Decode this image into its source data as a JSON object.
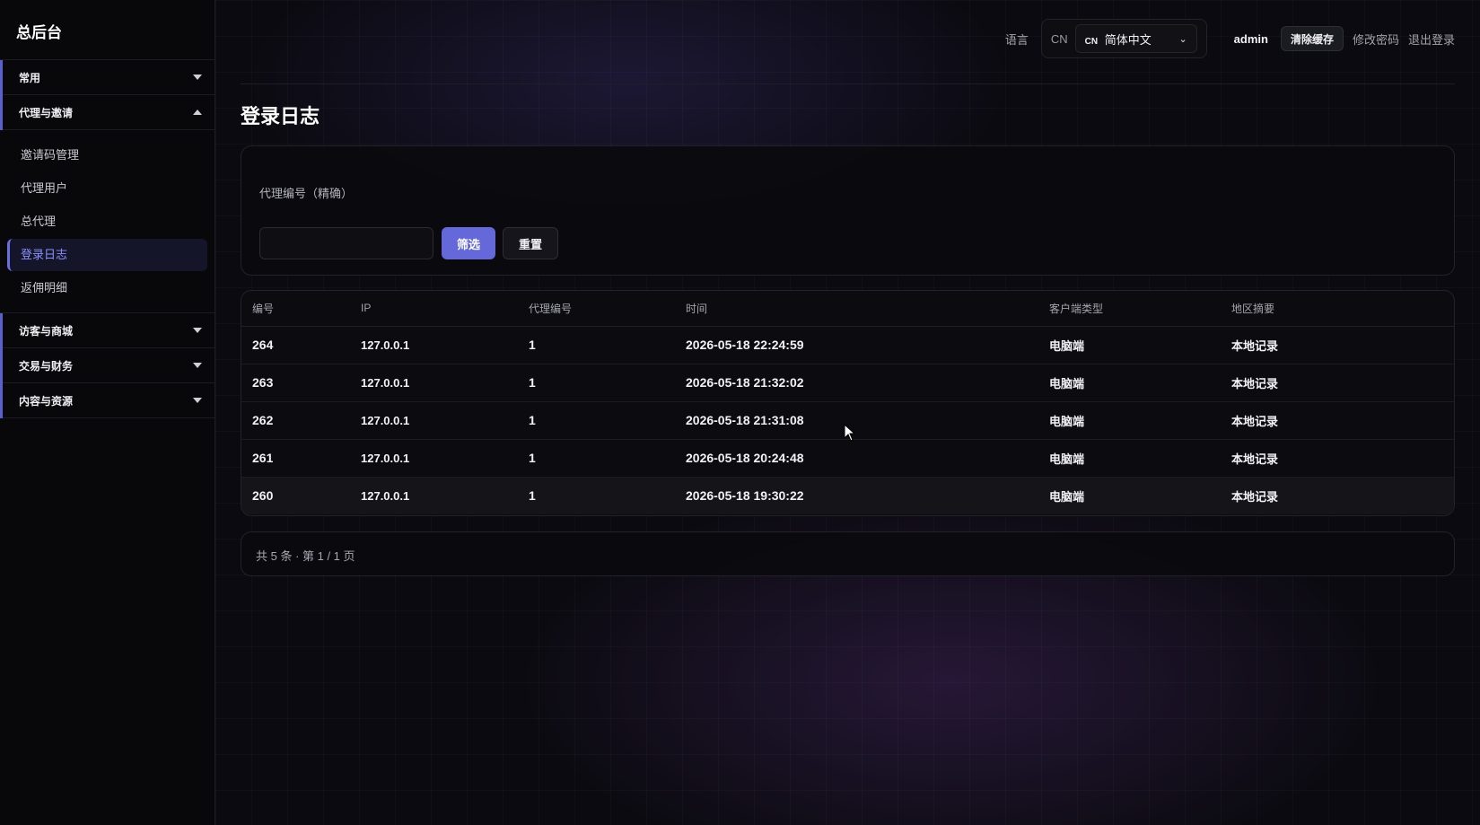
{
  "app": {
    "brand": "总后台"
  },
  "sidebar": {
    "groups": [
      {
        "label": "常用",
        "expanded": false
      },
      {
        "label": "代理与邀请",
        "expanded": true,
        "items": [
          {
            "label": "邀请码管理"
          },
          {
            "label": "代理用户"
          },
          {
            "label": "总代理"
          },
          {
            "label": "登录日志",
            "active": true
          },
          {
            "label": "返佣明细"
          }
        ]
      },
      {
        "label": "访客与商城",
        "expanded": false
      },
      {
        "label": "交易与财务",
        "expanded": false
      },
      {
        "label": "内容与资源",
        "expanded": false
      }
    ]
  },
  "header": {
    "lang_label": "语言",
    "lang_code": "CN",
    "lang_select_tag": "CN",
    "lang_select_value": "简体中文",
    "user": "admin",
    "clear_cache": "清除缓存",
    "change_password": "修改密码",
    "logout": "退出登录"
  },
  "page": {
    "title": "登录日志"
  },
  "filter": {
    "label": "代理编号（精确）",
    "input_value": "",
    "filter_button": "筛选",
    "reset_button": "重置"
  },
  "table": {
    "columns": [
      "编号",
      "IP",
      "代理编号",
      "时间",
      "客户端类型",
      "地区摘要"
    ],
    "rows": [
      [
        "264",
        "127.0.0.1",
        "1",
        "2026-05-18 22:24:59",
        "电脑端",
        "本地记录"
      ],
      [
        "263",
        "127.0.0.1",
        "1",
        "2026-05-18 21:32:02",
        "电脑端",
        "本地记录"
      ],
      [
        "262",
        "127.0.0.1",
        "1",
        "2026-05-18 21:31:08",
        "电脑端",
        "本地记录"
      ],
      [
        "261",
        "127.0.0.1",
        "1",
        "2026-05-18 20:24:48",
        "电脑端",
        "本地记录"
      ],
      [
        "260",
        "127.0.0.1",
        "1",
        "2026-05-18 19:30:22",
        "电脑端",
        "本地记录"
      ]
    ]
  },
  "pager": {
    "summary": "共 5 条 · 第 1 / 1 页"
  },
  "colors": {
    "accent": "#6468d8",
    "active_text": "#8b90ff",
    "background": "#0b0a10"
  }
}
